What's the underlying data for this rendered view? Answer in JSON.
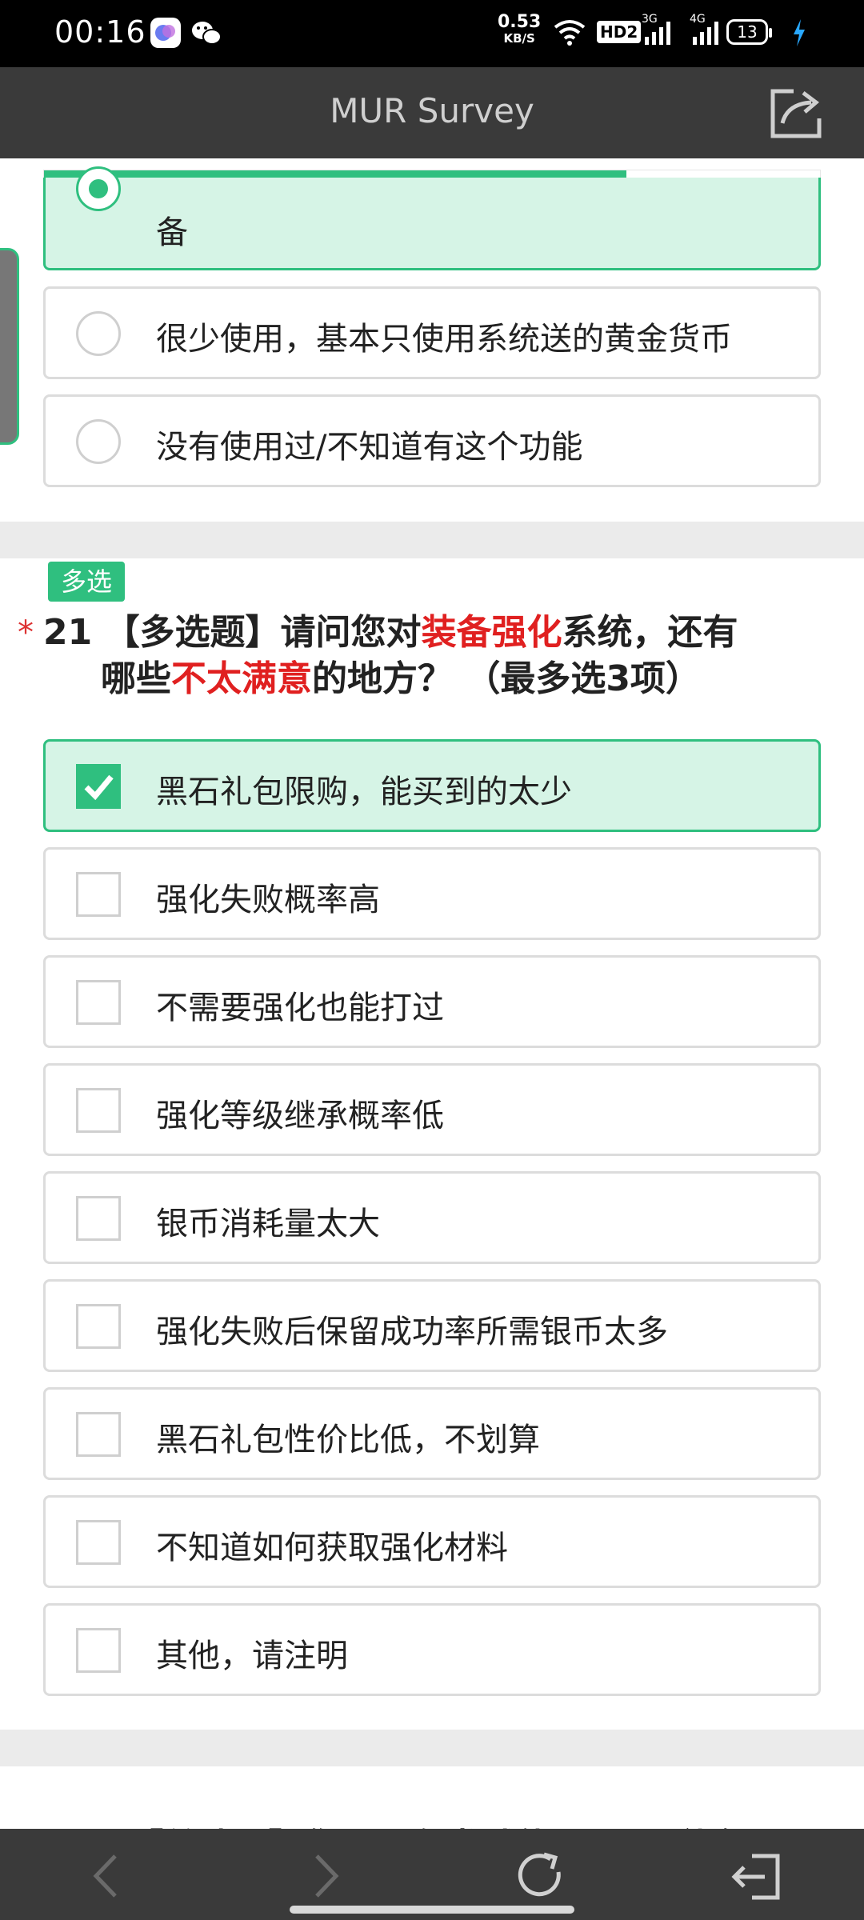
{
  "status_bar": {
    "time": "00:16",
    "net_speed": "0.53",
    "net_unit": "KB/S",
    "hd_label": "HD2",
    "sig1_label": "3G",
    "sig2_label": "4G",
    "battery": "13"
  },
  "header": {
    "title": "MUR Survey"
  },
  "progress": {
    "fraction": 0.75,
    "color": "#2fbf7f"
  },
  "previous_question": {
    "options": [
      {
        "label": "备",
        "selected": true
      },
      {
        "label": "很少使用，基本只使用系统送的黄金货币",
        "selected": false
      },
      {
        "label": "没有使用过/不知道有这个功能",
        "selected": false
      }
    ]
  },
  "question": {
    "badge": "多选",
    "required_mark": "*",
    "number": "21",
    "title_part1": "【多选题】请问您对",
    "title_highlight1": "装备强化",
    "title_part2": "系统，还有",
    "title_part3": "哪些",
    "title_highlight2": "不太满意",
    "title_part4": "的地方？ （最多选3项）",
    "options": [
      {
        "label": "黑石礼包限购，能买到的太少",
        "checked": true
      },
      {
        "label": "强化失败概率高",
        "checked": false
      },
      {
        "label": "不需要强化也能打过",
        "checked": false
      },
      {
        "label": "强化等级继承概率低",
        "checked": false
      },
      {
        "label": "银币消耗量太大",
        "checked": false
      },
      {
        "label": "强化失败后保留成功率所需银币太多",
        "checked": false
      },
      {
        "label": "黑石礼包性价比低，不划算",
        "checked": false
      },
      {
        "label": "不知道如何获取强化材料",
        "checked": false
      },
      {
        "label": "其他，请注明",
        "checked": false
      }
    ]
  },
  "next_question_peek": "【单选题】您是否有尝试使用“黑石礼包”",
  "colors": {
    "accent": "#2fbf7f",
    "highlight": "#e02020",
    "header_bg": "#3a3a3a"
  }
}
